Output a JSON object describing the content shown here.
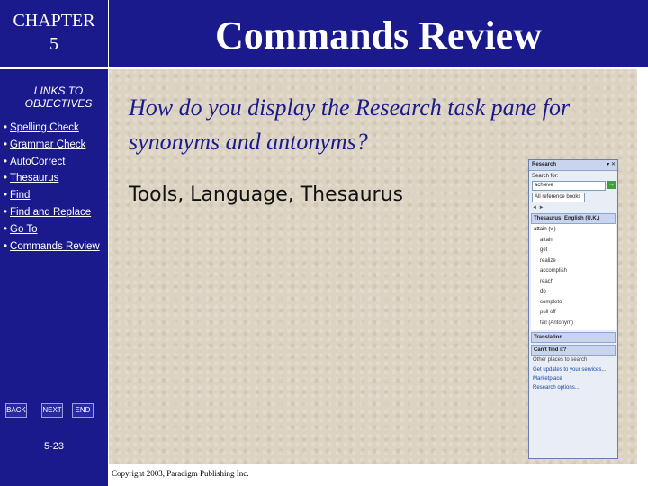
{
  "sidebar": {
    "chapter_line1": "CHAPTER",
    "chapter_line2": "5",
    "links_heading_line1": "LINKS TO",
    "links_heading_line2": "OBJECTIVES",
    "links": [
      "Spelling Check",
      "Grammar Check",
      "AutoCorrect",
      "Thesaurus",
      "Find",
      "Find and Replace",
      "Go To",
      "Commands Review"
    ],
    "nav": {
      "back": "BACK",
      "next": "NEXT",
      "end": "END"
    },
    "slide_number": "5-23"
  },
  "header": {
    "title": "Commands Review"
  },
  "main": {
    "question": "How do you display the Research task pane for synonyms and antonyms?",
    "answer": "Tools, Language, Thesaurus"
  },
  "research_pane": {
    "title": "Research",
    "search_for_label": "Search for:",
    "search_value": "achieve",
    "reference_value": "All reference books",
    "section_title": "Thesaurus: English (U.K.)",
    "results": [
      "attain (v.)",
      "attain",
      "get",
      "realize",
      "accomplish",
      "reach",
      "do",
      "complete",
      "pull off",
      "fail (Antonym)"
    ],
    "translation_label": "Translation",
    "cant_find_label": "Can't find it?",
    "other_places_label": "Other places to search",
    "footer_link1": "Get updates to your services...",
    "footer_link2": "Marketplace",
    "footer_link3": "Research options..."
  },
  "footer": {
    "copyright": "Copyright 2003, Paradigm Publishing Inc."
  }
}
